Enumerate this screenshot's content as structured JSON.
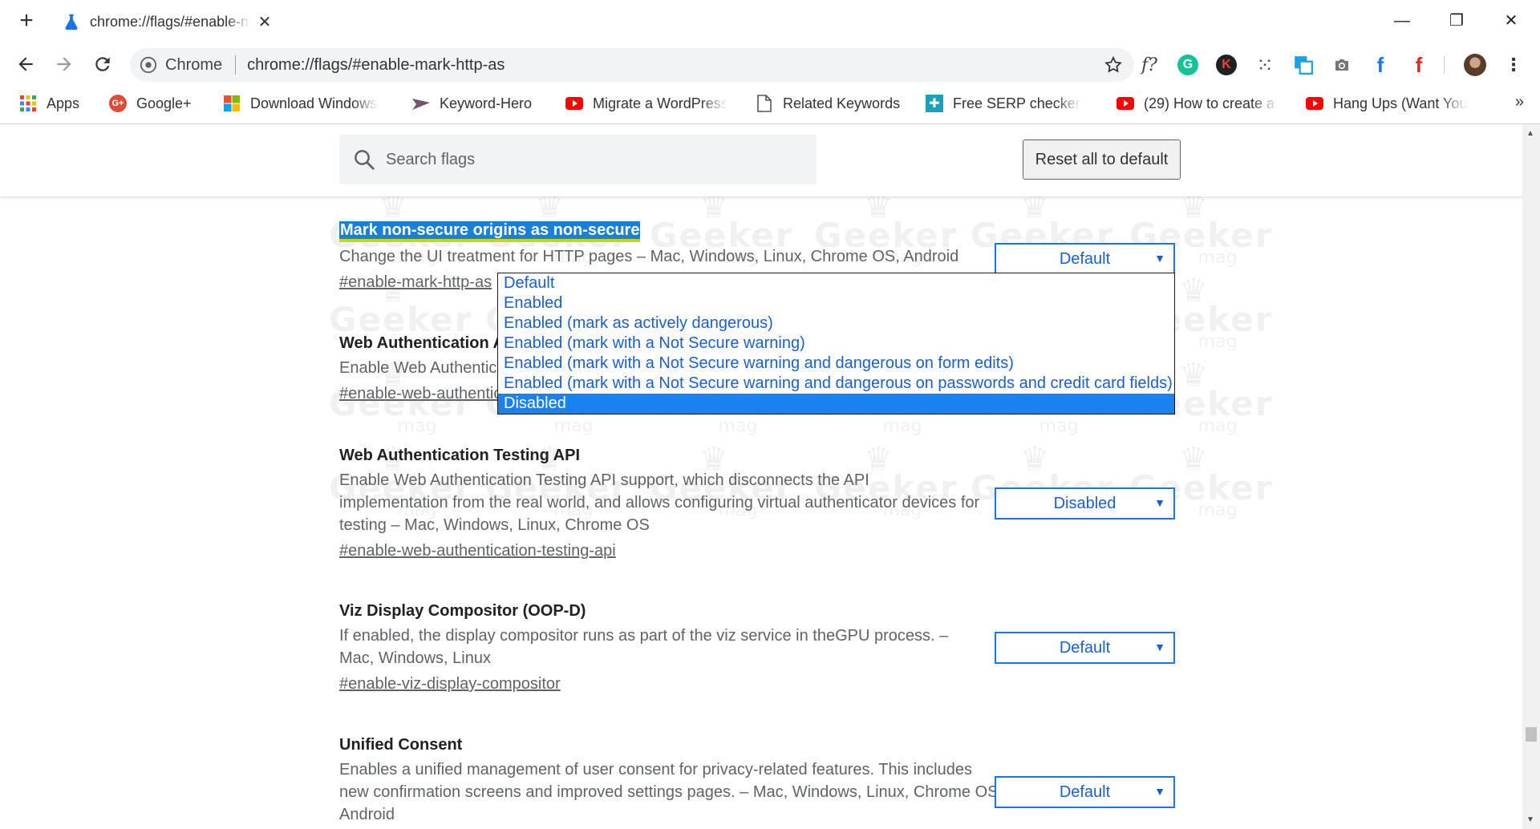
{
  "tab": {
    "title": "chrome://flags/#enable-mark-http-as",
    "close": "✕"
  },
  "window_controls": {
    "minimize": "—",
    "restore": "❐",
    "close": "✕"
  },
  "omnibox": {
    "site": "Chrome",
    "url": "chrome://flags/#enable-mark-http-as"
  },
  "extensions": [
    {
      "name": "formula-icon",
      "glyph": "f?"
    },
    {
      "name": "grammarly-icon",
      "glyph": "G",
      "color": "#15c39a"
    },
    {
      "name": "k-extension-icon",
      "glyph": "K",
      "color": "#202124"
    },
    {
      "name": "dots-grid-icon",
      "glyph": "⁙"
    },
    {
      "name": "copy-extension-icon",
      "glyph": "⧉",
      "color": "#1aa1e6"
    },
    {
      "name": "camera-icon",
      "glyph": "📷"
    },
    {
      "name": "facebook-icon",
      "glyph": "f",
      "color": "#1877f2"
    },
    {
      "name": "flipboard-icon",
      "glyph": "f",
      "color": "#e12828"
    }
  ],
  "bookmarks": [
    {
      "label": "Apps"
    },
    {
      "label": "Google+"
    },
    {
      "label": "Download Windows"
    },
    {
      "label": "Keyword-Hero"
    },
    {
      "label": "Migrate a WordPress"
    },
    {
      "label": "Related Keywords"
    },
    {
      "label": "Free SERP checker -"
    },
    {
      "label": "(29) How to create a"
    },
    {
      "label": "Hang Ups (Want You"
    }
  ],
  "bookmarks_more": "»",
  "search": {
    "placeholder": "Search flags"
  },
  "reset_label": "Reset all to default",
  "experiments": [
    {
      "title": "Mark non-secure origins as non-secure",
      "description": "Change the UI treatment for HTTP pages – Mac, Windows, Linux, Chrome OS, Android",
      "link": "#enable-mark-http-as",
      "value": "Default"
    },
    {
      "title": "Web Authentication AP",
      "description": "Enable Web Authentica",
      "link": "#enable-web-authentic"
    },
    {
      "title": "Web Authentication Testing API",
      "description": "Enable Web Authentication Testing API support, which disconnects the API implementation from the real world, and allows configuring virtual authenticator devices for testing – Mac, Windows, Linux, Chrome OS",
      "link": "#enable-web-authentication-testing-api",
      "value": "Disabled"
    },
    {
      "title": "Viz Display Compositor (OOP-D)",
      "description": "If enabled, the display compositor runs as part of the viz service in theGPU process. – Mac, Windows, Linux",
      "link": "#enable-viz-display-compositor",
      "value": "Default"
    },
    {
      "title": "Unified Consent",
      "description": "Enables a unified management of user consent for privacy-related features. This includes new confirmation screens and improved settings pages. – Mac, Windows, Linux, Chrome OS, Android",
      "value": "Default"
    }
  ],
  "dropdown_options": [
    "Default",
    "Enabled",
    "Enabled (mark as actively dangerous)",
    "Enabled (mark with a Not Secure warning)",
    "Enabled (mark with a Not Secure warning and dangerous on form edits)",
    "Enabled (mark with a Not Secure warning and dangerous on passwords and credit card fields)",
    "Disabled"
  ],
  "dropdown_selected_index": 6,
  "watermark": {
    "text": "Geeker",
    "sub": "mag"
  },
  "colors": {
    "accent": "#1a73e8",
    "select_text": "#1a5fd1",
    "highlight": "#1b7fd6",
    "option_selected_bg": "#1a82f0"
  }
}
